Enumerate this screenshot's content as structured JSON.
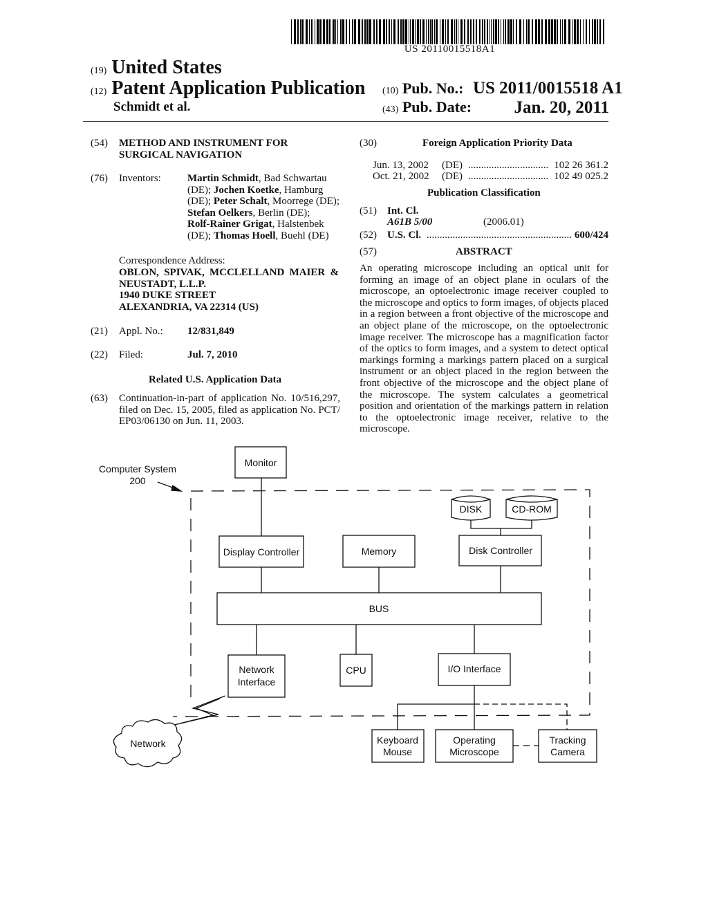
{
  "header": {
    "barcode_number": "US 20110015518A1",
    "country_code": "(19)",
    "country": "United States",
    "pub_type_code": "(12)",
    "pub_type": "Patent Application Publication",
    "authors": "Schmidt et al.",
    "pub_no_code": "(10)",
    "pub_no_label": "Pub. No.:",
    "pub_no": "US 2011/0015518 A1",
    "pub_date_code": "(43)",
    "pub_date_label": "Pub. Date:",
    "pub_date": "Jan. 20, 2011"
  },
  "left_column": {
    "title": {
      "code": "(54)",
      "line1": "METHOD AND INSTRUMENT FOR",
      "line2": "SURGICAL NAVIGATION"
    },
    "inventors": {
      "code": "(76)",
      "label": "Inventors:",
      "lines": [
        [
          {
            "t": "Martin Schmidt",
            "b": true
          },
          {
            "t": ", Bad Schwartau",
            "b": false
          }
        ],
        [
          {
            "t": "(DE); ",
            "b": false
          },
          {
            "t": "Jochen Koetke",
            "b": true
          },
          {
            "t": ", Hamburg",
            "b": false
          }
        ],
        [
          {
            "t": "(DE); ",
            "b": false
          },
          {
            "t": "Peter Schalt",
            "b": true
          },
          {
            "t": ", Moorrege (DE);",
            "b": false
          }
        ],
        [
          {
            "t": "Stefan Oelkers",
            "b": true
          },
          {
            "t": ", Berlin (DE);",
            "b": false
          }
        ],
        [
          {
            "t": "Rolf-Rainer Grigat",
            "b": true
          },
          {
            "t": ", Halstenbek",
            "b": false
          }
        ],
        [
          {
            "t": "(DE); ",
            "b": false
          },
          {
            "t": "Thomas Hoell",
            "b": true
          },
          {
            "t": ", Buehl (DE)",
            "b": false
          }
        ]
      ]
    },
    "correspondence": {
      "label": "Correspondence Address:",
      "lines": [
        "OBLON, SPIVAK, MCCLELLAND MAIER &",
        "NEUSTADT, L.L.P.",
        "1940 DUKE STREET",
        "ALEXANDRIA, VA 22314 (US)"
      ]
    },
    "appl_no": {
      "code": "(21)",
      "label": "Appl. No.:",
      "value": "12/831,849"
    },
    "filed": {
      "code": "(22)",
      "label": "Filed:",
      "value": "Jul. 7, 2010"
    },
    "related": {
      "heading": "Related U.S. Application Data",
      "code": "(63)",
      "lines": [
        "Continuation-in-part of application No. 10/516,297,",
        "filed on Dec. 15, 2005, filed as application No. PCT/",
        "EP03/06130 on Jun. 11, 2003."
      ]
    }
  },
  "right_column": {
    "foreign_priority": {
      "code": "(30)",
      "heading": "Foreign Application Priority Data",
      "entries": [
        {
          "date": "Jun. 13, 2002",
          "country": "(DE)",
          "number": "102 26 361.2"
        },
        {
          "date": "Oct. 21, 2002",
          "country": "(DE)",
          "number": "102 49 025.2"
        }
      ]
    },
    "classification": {
      "heading": "Publication Classification",
      "int_cl": {
        "code": "(51)",
        "label": "Int. Cl.",
        "class": "A61B 5/00",
        "version": "(2006.01)"
      },
      "us_cl": {
        "code": "(52)",
        "label": "U.S. Cl.",
        "value": "600/424"
      }
    },
    "abstract": {
      "code": "(57)",
      "heading": "ABSTRACT",
      "text": "An operating microscope including an optical unit for forming an image of an object plane in oculars of the microscope, an optoelectronic image receiver coupled to the microscope and optics to form images, of objects placed in a region between a front objective of the microscope and an object plane of the microscope, on the optoelectronic image receiver. The microscope has a magnification factor of the optics to form images, and a system to detect optical markings forming a markings pattern placed on a surgical instrument or an object placed in the region between the front objective of the microscope and the object plane of the microscope. The system calculates a geometrical position and orientation of the markings pattern in relation to the optoelectronic image receiver, relative to the microscope."
    }
  },
  "diagram": {
    "system_label_line1": "Computer System",
    "system_label_line2": "200",
    "nodes": {
      "monitor": "Monitor",
      "display_controller": "Display Controller",
      "memory": "Memory",
      "disk_controller": "Disk Controller",
      "disk": "DISK",
      "cdrom": "CD-ROM",
      "bus": "BUS",
      "network_interface_1": "Network",
      "network_interface_2": "Interface",
      "cpu": "CPU",
      "io_interface": "I/O Interface",
      "network": "Network",
      "keyboard_mouse_1": "Keyboard",
      "keyboard_mouse_2": "Mouse",
      "microscope_1": "Operating",
      "microscope_2": "Microscope",
      "camera_1": "Tracking",
      "camera_2": "Camera"
    }
  }
}
